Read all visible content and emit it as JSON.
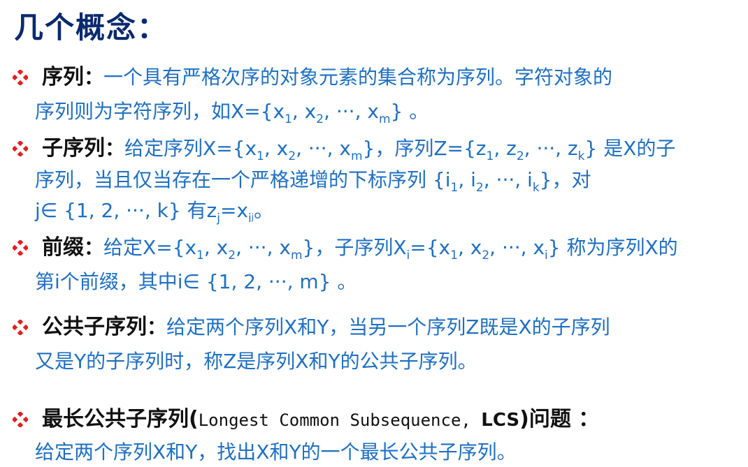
{
  "title": "几个概念：",
  "items": [
    {
      "term": "序列",
      "colon": "：",
      "def_a": "一个具有严格次序的对象元素的集合称为序列。字符对象的",
      "def_b_a": "序列则为字符序列，如X={x",
      "s1": "1",
      "def_b_b": ", x",
      "s2": "2",
      "def_b_c": ", ···, x",
      "sm": "m",
      "def_b_d": "} 。"
    },
    {
      "term": "子序列",
      "colon": "：",
      "l1_a": "给定序列X={x",
      "l1_s1": "1",
      "l1_b": ", x",
      "l1_s2": "2",
      "l1_c": ", ···, x",
      "l1_sm": "m",
      "l1_d": "}，序列Z={z",
      "l1_z1": "1",
      "l1_e": ", z",
      "l1_z2": "2",
      "l1_f": ", ···, z",
      "l1_zk": "k",
      "l1_g": "} 是X的子",
      "l2_a": "序列，当且仅当存在一个严格递增的下标序列 {i",
      "l2_s1": "1",
      "l2_b": ", i",
      "l2_s2": "2",
      "l2_c": ", ···, i",
      "l2_sk": "k",
      "l2_d": "}，对",
      "l3_a": "j∈ {1, 2, ···, k} 有z",
      "l3_sj": "j",
      "l3_b": "=x",
      "l3_si": "i",
      "l3_sj2": "j",
      "l3_c": "。"
    },
    {
      "term": "前缀",
      "colon": "：",
      "l1_a": "给定X={x",
      "l1_s1": "1",
      "l1_b": ", x",
      "l1_s2": "2",
      "l1_c": ", ···, x",
      "l1_sm": "m",
      "l1_d": "}，子序列X",
      "l1_si": "i",
      "l1_e": "={x",
      "l1_s1b": "1",
      "l1_f": ", x",
      "l1_s2b": "2",
      "l1_g": ", ···, x",
      "l1_sib": "i",
      "l1_h": "} 称为序列X的",
      "l2": "第i个前缀，其中i∈ {1, 2, ···, m} 。"
    },
    {
      "term": "公共子序列",
      "colon": "：",
      "l1": "给定两个序列X和Y，当另一个序列Z既是X的子序列",
      "l2": "又是Y的子序列时，称Z是序列X和Y的公共子序列。"
    },
    {
      "term": "最长公共子序列",
      "paren_open": "(",
      "english": "Longest Common Subsequence, ",
      "abbr": "LCS",
      "paren_close": ")问题 ：",
      "l2": "给定两个序列X和Y，找出X和Y的一个最长公共子序列。"
    }
  ],
  "colors": {
    "title": "#0a2a6e",
    "text": "#1f6fc0",
    "term": "#111111",
    "bullet": "#e02020"
  },
  "icons": {
    "bullet": "diamond-bullet-icon"
  }
}
